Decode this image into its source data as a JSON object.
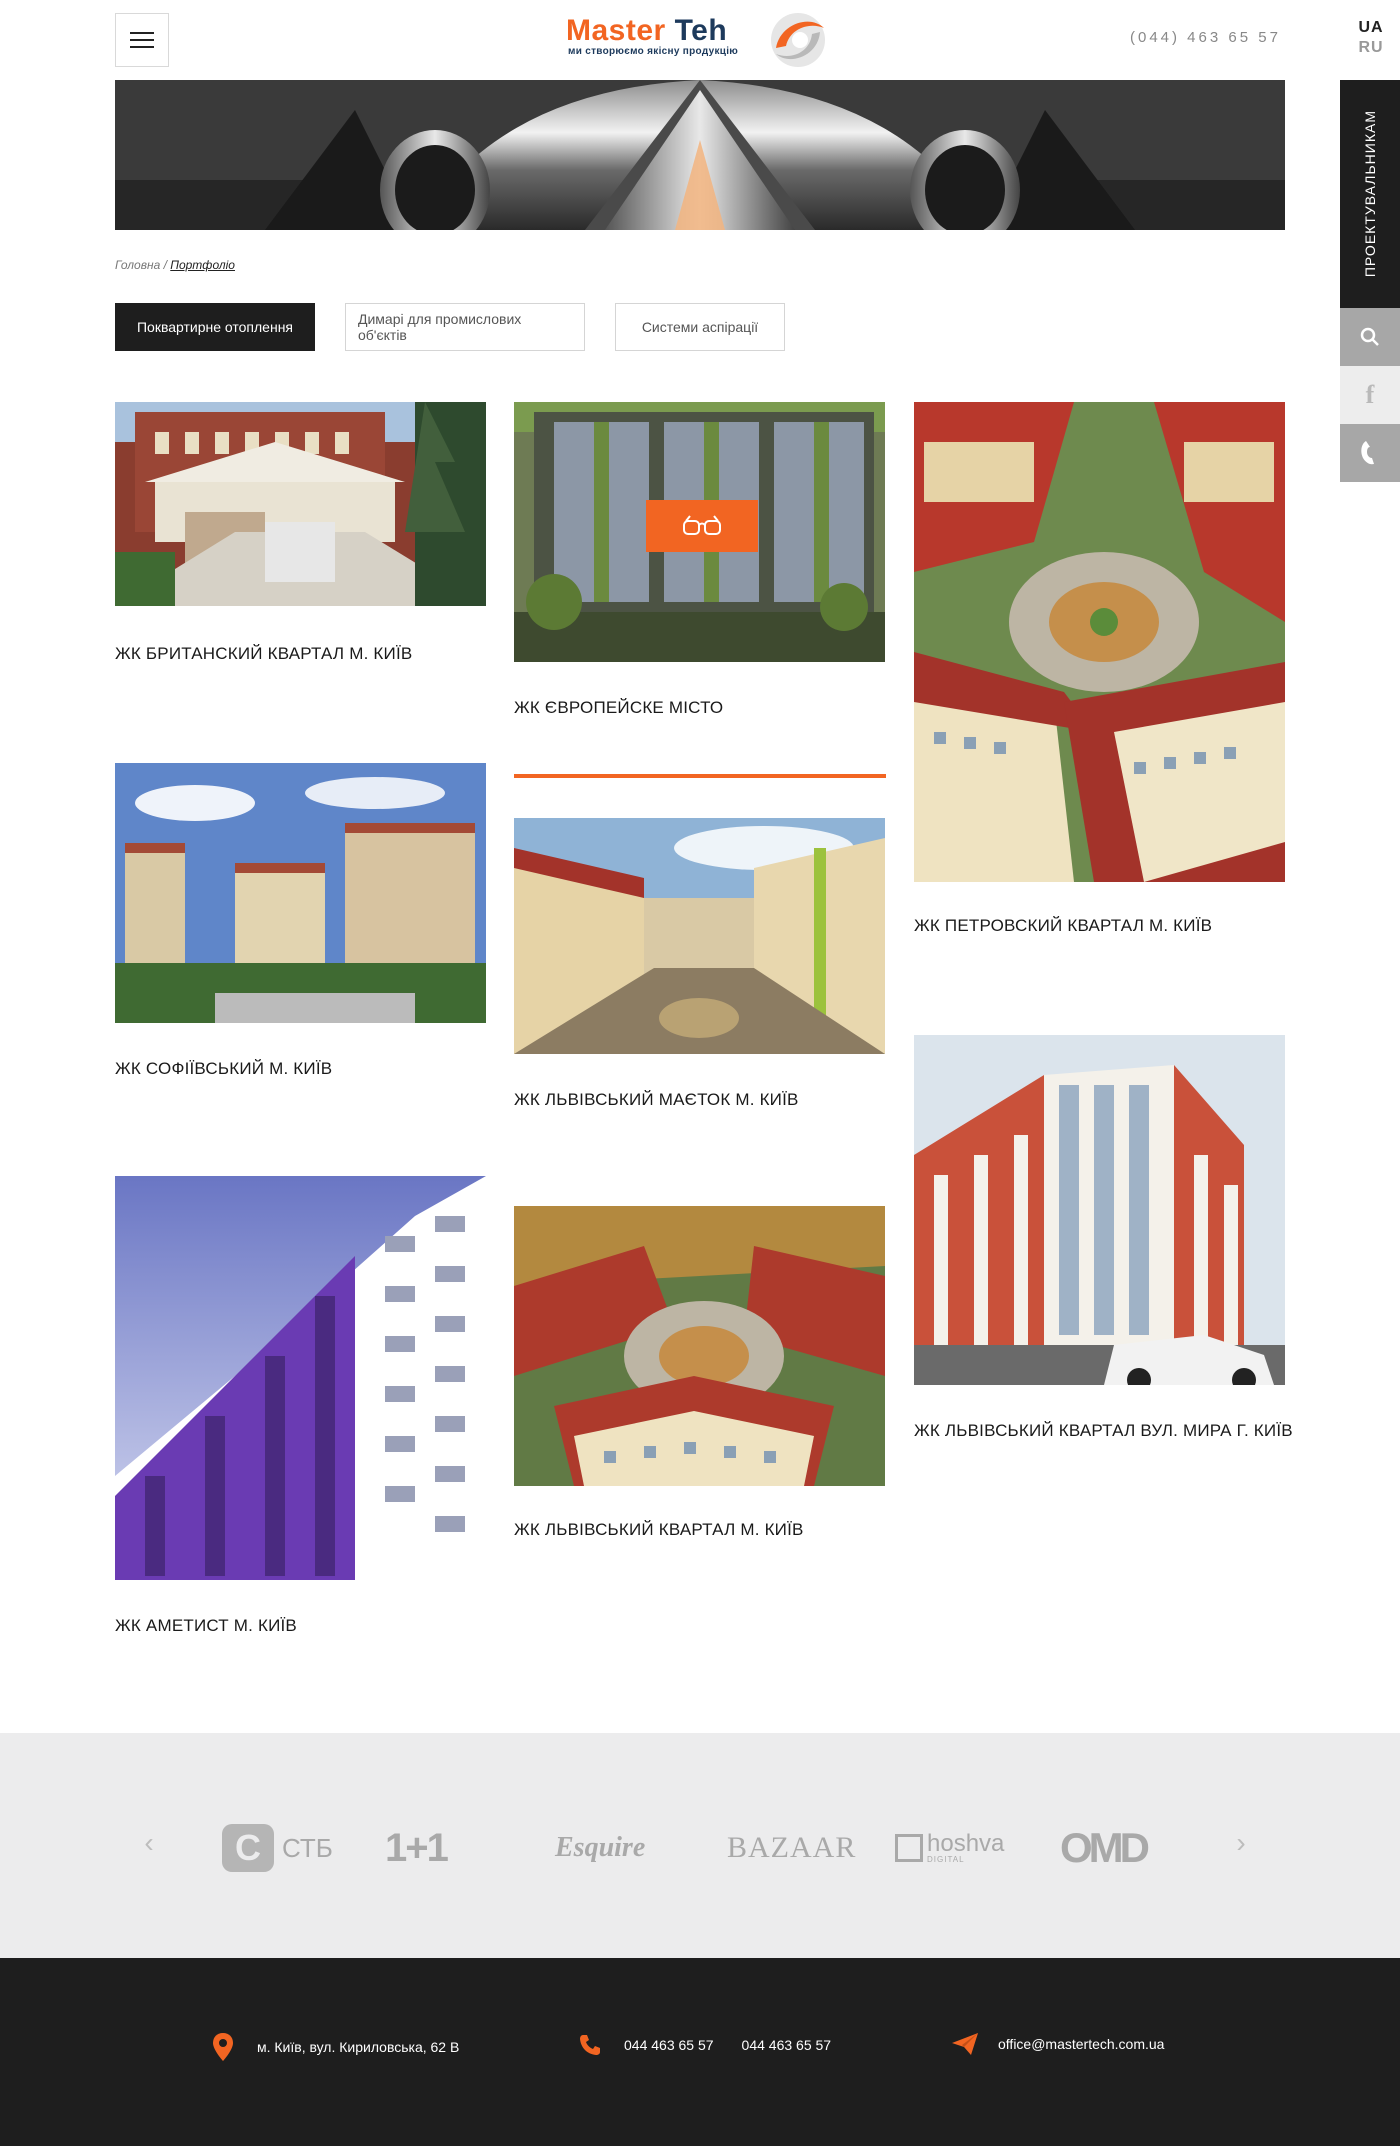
{
  "header": {
    "logo_word_1": "Master",
    "logo_word_2": "Teh",
    "logo_tagline": "ми створюємо якісну продукцію",
    "phone": "(044) 463 65 57",
    "lang_active": "UA",
    "lang_other": "RU"
  },
  "side": {
    "designers_label": "ПРОЕКТУВАЛЬНИКАМ",
    "fb_glyph": "f"
  },
  "breadcrumb": {
    "home": "Головна",
    "separator": " / ",
    "current": "Портфоліо"
  },
  "filters": [
    {
      "label": "Поквартирне отоплення",
      "active": true
    },
    {
      "label": "Димарі для промислових об'єктів",
      "active": false
    },
    {
      "label": "Системи аспірації",
      "active": false
    }
  ],
  "portfolio": [
    {
      "caption": "ЖК БРИТАНСКИЙ КВАРТАЛ М. КИЇВ"
    },
    {
      "caption": "ЖК ЄВРОПЕЙСКЕ МІСТО"
    },
    {
      "caption": "ЖК ПЕТРОВСКИЙ КВАРТАЛ М. КИЇВ"
    },
    {
      "caption": "ЖК СОФІЇВСЬКИЙ М. КИЇВ"
    },
    {
      "caption": "ЖК ЛЬВІВСЬКИЙ МАЄТОК М. КИЇВ"
    },
    {
      "caption": "ЖК ЛЬВІВСЬКИЙ КВАРТАЛ ВУЛ. МИРА Г. КИЇВ"
    },
    {
      "caption": "ЖК АМЕТИСТ М. КИЇВ"
    },
    {
      "caption": "ЖК ЛЬВІВСЬКИЙ КВАРТАЛ М. КИЇВ"
    }
  ],
  "partners": {
    "prev": "‹",
    "next": "›",
    "logos": [
      "СТБ",
      "1+1",
      "Esquire",
      "BAZAAR",
      "hoshva",
      "OMD"
    ],
    "stb_glyph": "C",
    "hoshva_sub": "DIGITAL"
  },
  "footer": {
    "address": "м. Київ, вул. Кириловська, 62 В",
    "phone_1": "044 463 65 57",
    "phone_2": "044 463 65 57",
    "email": "office@mastertech.com.ua"
  },
  "colors": {
    "accent": "#f26522",
    "dark": "#1e1e1e",
    "brand_blue": "#1d3a5c"
  }
}
